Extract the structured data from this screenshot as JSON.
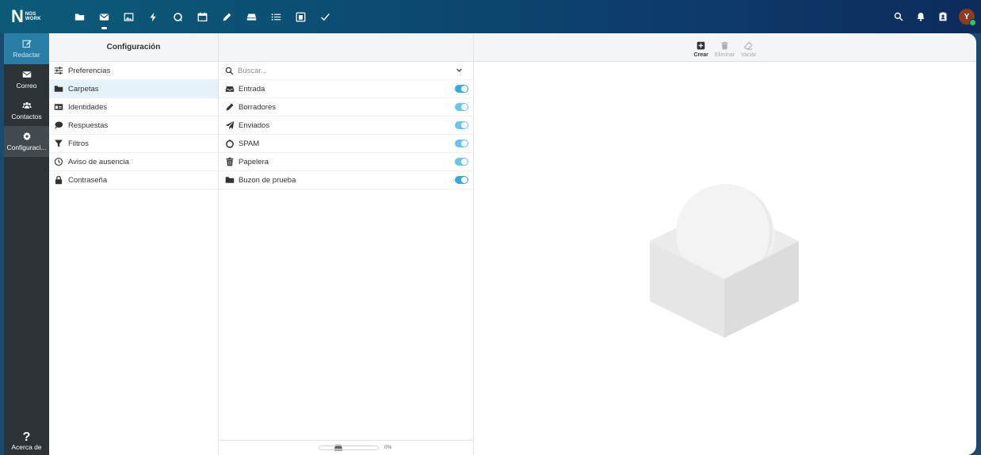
{
  "brand": {
    "logo_letter": "N",
    "logo_line1": "NOS",
    "logo_line2": "WORK"
  },
  "topbar": {
    "apps": [
      {
        "name": "folder-icon"
      },
      {
        "name": "mail-icon",
        "active": true
      },
      {
        "name": "image-icon"
      },
      {
        "name": "lightning-icon"
      },
      {
        "name": "chat-icon"
      },
      {
        "name": "calendar-icon"
      },
      {
        "name": "pencil-icon"
      },
      {
        "name": "drive-icon"
      },
      {
        "name": "list-icon"
      },
      {
        "name": "presentation-icon"
      },
      {
        "name": "check-icon"
      }
    ],
    "right_icons": [
      "search-icon",
      "bell-icon",
      "contact-card-icon"
    ],
    "avatar_initial": "Y"
  },
  "leftnav": {
    "compose": "Redactar",
    "mail": "Correo",
    "contacts": "Contactos",
    "settings": "Configuraci...",
    "about": "Acerca de"
  },
  "settings_panel": {
    "title": "Configuración",
    "items": [
      {
        "label": "Preferencias",
        "icon": "sliders-icon"
      },
      {
        "label": "Carpetas",
        "icon": "folder-icon",
        "selected": true
      },
      {
        "label": "Identidades",
        "icon": "id-card-icon"
      },
      {
        "label": "Respuestas",
        "icon": "comment-icon"
      },
      {
        "label": "Filtros",
        "icon": "filter-icon"
      },
      {
        "label": "Aviso de ausencia",
        "icon": "clock-icon"
      },
      {
        "label": "Contraseña",
        "icon": "lock-icon"
      }
    ]
  },
  "folders_panel": {
    "search_placeholder": "Buscar...",
    "folders": [
      {
        "label": "Entrada",
        "icon": "inbox-icon",
        "subscribed": true
      },
      {
        "label": "Borradores",
        "icon": "pencil-icon",
        "subscribed": true
      },
      {
        "label": "Enviados",
        "icon": "send-icon",
        "subscribed": true
      },
      {
        "label": "SPAM",
        "icon": "spam-icon",
        "subscribed": true
      },
      {
        "label": "Papelera",
        "icon": "trash-icon",
        "subscribed": true
      },
      {
        "label": "Buzon de prueba",
        "icon": "folder-icon",
        "subscribed": true
      }
    ],
    "quota_percent": "0%"
  },
  "detail_toolbar": {
    "create": "Crear",
    "delete": "Eliminar",
    "empty": "Vaciar"
  },
  "colors": {
    "accent": "#37a8dc",
    "nav_bg": "#2c3236",
    "compose_bg": "#2a7ea6",
    "topbar_start": "#0d5a78",
    "topbar_end": "#0d2b5c"
  }
}
